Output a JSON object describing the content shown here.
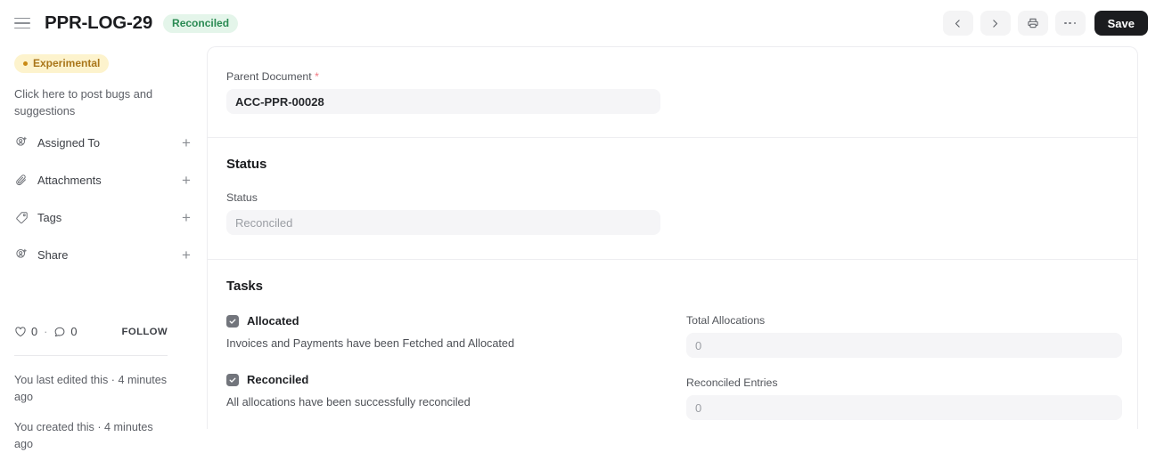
{
  "header": {
    "menu_icon": "hamburger-icon",
    "title": "PPR-LOG-29",
    "status_badge": "Reconciled",
    "actions": {
      "prev_icon": "chevron-left-icon",
      "next_icon": "chevron-right-icon",
      "print_icon": "printer-icon",
      "more_icon": "ellipsis-icon",
      "save_label": "Save"
    }
  },
  "sidebar": {
    "experimental_badge": "Experimental",
    "note": "Click here to post bugs and suggestions",
    "items": [
      {
        "label": "Assigned To",
        "icon": "user-plus-icon",
        "add": "+"
      },
      {
        "label": "Attachments",
        "icon": "paperclip-icon",
        "add": "+"
      },
      {
        "label": "Tags",
        "icon": "tag-icon",
        "add": "+"
      },
      {
        "label": "Share",
        "icon": "user-plus-icon",
        "add": "+"
      }
    ],
    "social": {
      "like_icon": "heart-icon",
      "like_count": "0",
      "separator": "·",
      "comment_icon": "comment-icon",
      "comment_count": "0",
      "follow_label": "FOLLOW"
    },
    "last_edited": "You last edited this · 4 minutes ago",
    "created": "You created this · 4 minutes ago"
  },
  "main": {
    "parent_section": {
      "label": "Parent Document",
      "required_marker": "*",
      "value": "ACC-PPR-00028"
    },
    "status_section": {
      "title": "Status",
      "field_label": "Status",
      "value": "Reconciled"
    },
    "tasks_section": {
      "title": "Tasks",
      "tasks": [
        {
          "label": "Allocated",
          "checked": true,
          "description": "Invoices and Payments have been Fetched and Allocated"
        },
        {
          "label": "Reconciled",
          "checked": true,
          "description": "All allocations have been successfully reconciled"
        }
      ],
      "counters": [
        {
          "label": "Total Allocations",
          "value": "0"
        },
        {
          "label": "Reconciled Entries",
          "value": "0"
        }
      ]
    }
  },
  "colors": {
    "accent_dark": "#1b1c1f",
    "status_green_bg": "#e4f5ea",
    "status_green_text": "#2a8a53",
    "experimental_bg": "#fdf3cd",
    "experimental_text": "#a9761a",
    "field_bg": "#f5f5f7",
    "required_star": "#f0757f",
    "checkbox_fill": "#72757c"
  }
}
